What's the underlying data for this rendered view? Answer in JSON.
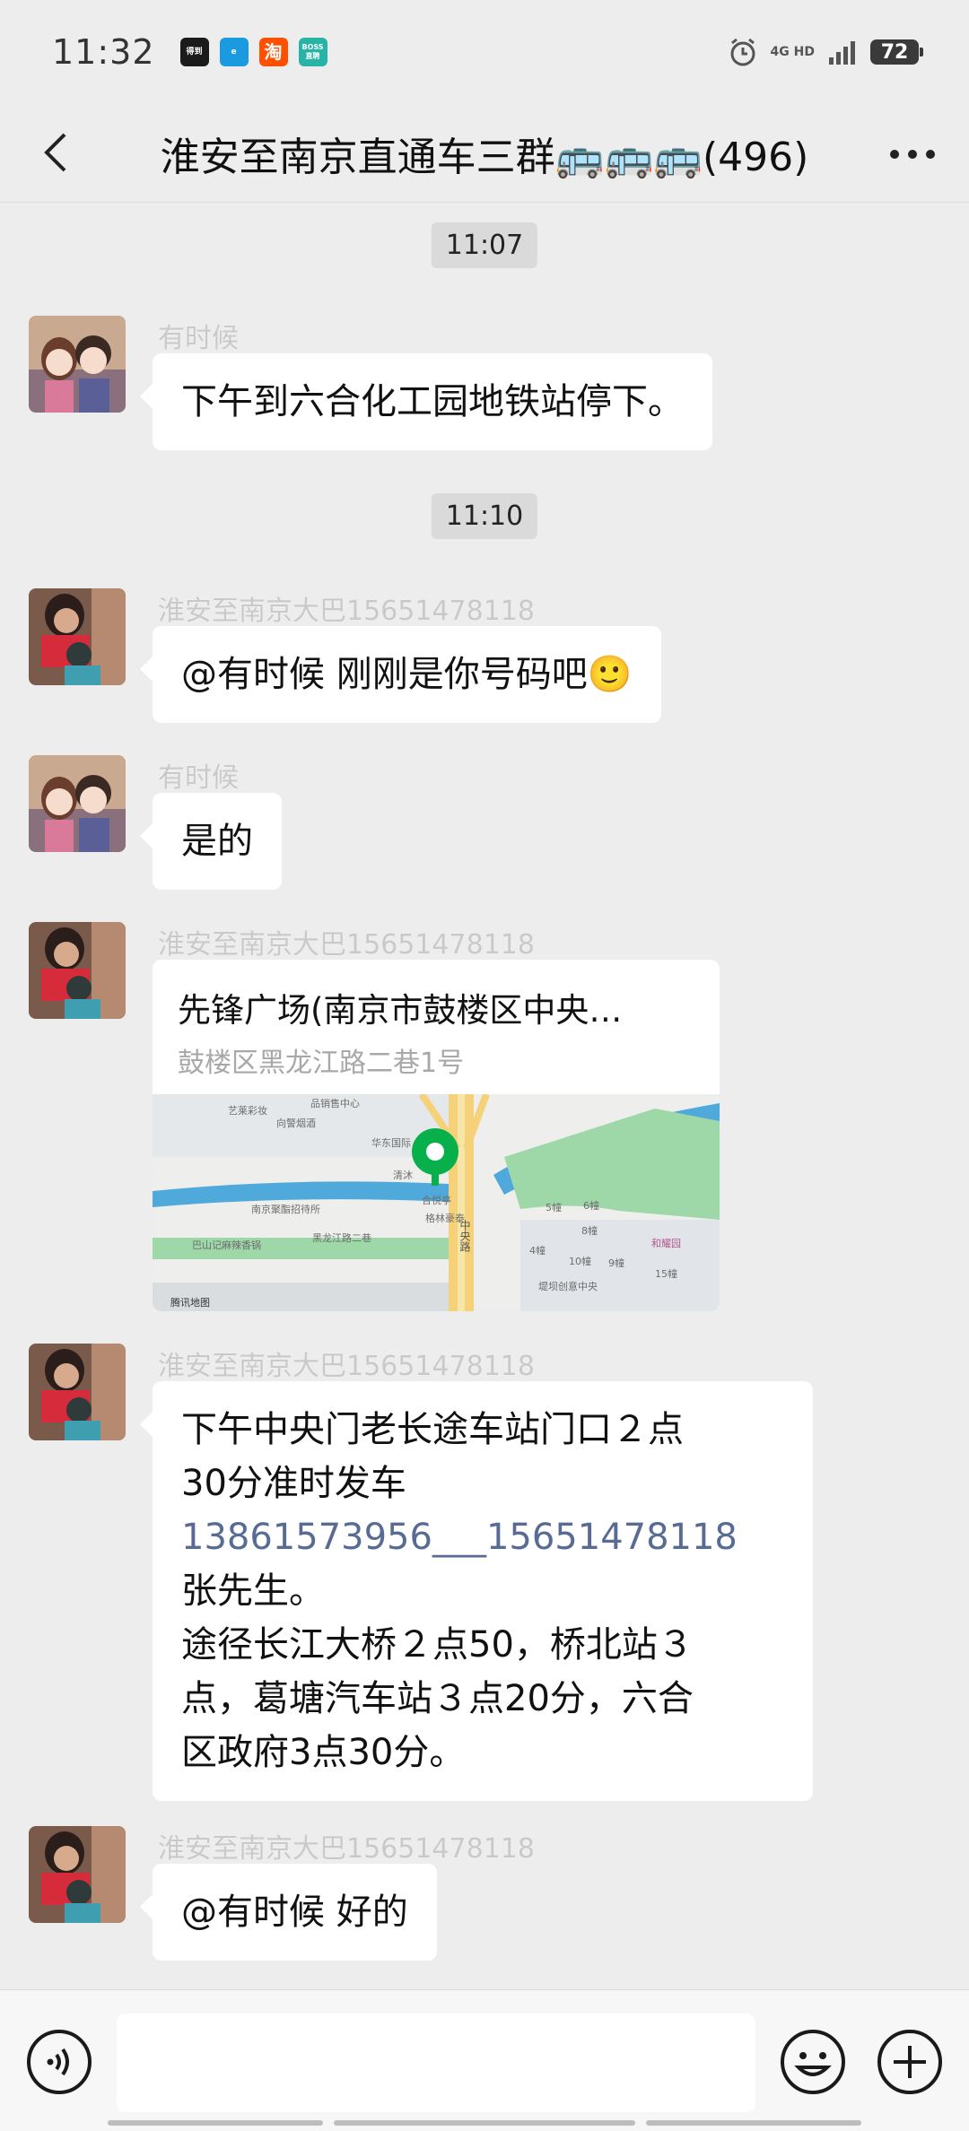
{
  "status_bar": {
    "time": "11:32",
    "app_icons": [
      {
        "name": "news-app-icon",
        "label": "得到",
        "color": "#1b1b1b"
      },
      {
        "name": "browser-app-icon",
        "label": "e",
        "color": "#1a9be0"
      },
      {
        "name": "taobao-app-icon",
        "label": "淘",
        "color": "#ff5000"
      },
      {
        "name": "boss-app-icon",
        "label": "BOSS直聘",
        "color": "#27b3a6"
      }
    ],
    "network": "4G HD",
    "battery": "72"
  },
  "header": {
    "title": "淮安至南京直通车三群🚌🚌🚌(496)"
  },
  "chat": {
    "timestamps": [
      "11:07",
      "11:10"
    ],
    "messages": [
      {
        "sender": "有时候",
        "text": "下午到六合化工园地铁站停下。"
      },
      {
        "sender": "淮安至南京大巴15651478118",
        "text": "@有时候  刚刚是你号码吧🙂"
      },
      {
        "sender": "有时候",
        "text": "是的"
      },
      {
        "sender": "淮安至南京大巴15651478118",
        "location": {
          "name": "先锋广场(南京市鼓楼区中央…",
          "address": "鼓楼区黑龙江路二巷1号",
          "map_labels": [
            "艺莱彩妆",
            "向警烟酒",
            "品销售中心",
            "华东国际",
            "清沐",
            "合悦亭",
            "格林豪泰",
            "南京聚酯招待所",
            "巴山记麻辣香锅",
            "黑龙江路二巷",
            "中央路",
            "5幢",
            "6幢",
            "8幢",
            "4幢",
            "10幢",
            "9幢",
            "15幢",
            "和耀园",
            "堤坝创意中央"
          ],
          "map_credit": "腾讯地图"
        }
      },
      {
        "sender": "淮安至南京大巴15651478118",
        "text_lines": {
          "line1": "下午中央门老长途车站门口２点",
          "line2": "30分准时发车",
          "phones": "13861573956___15651478118",
          "line4": "张先生。",
          "line5": "途径长江大桥２点50，桥北站３",
          "line6": "点，葛塘汽车站３点20分，六合",
          "line7": "区政府3点30分。"
        }
      },
      {
        "sender": "淮安至南京大巴15651478118",
        "text": "@有时候  好的"
      }
    ]
  },
  "input_bar": {
    "placeholder": ""
  }
}
